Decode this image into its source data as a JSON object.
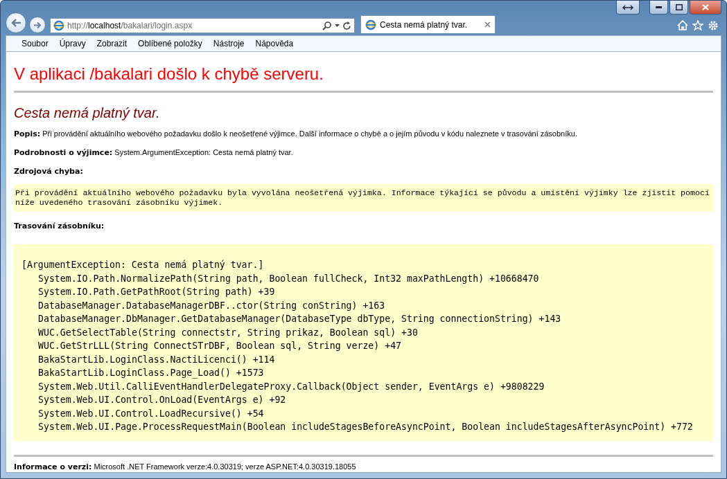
{
  "browser": {
    "address_scheme": "http://",
    "address_host": "localhost",
    "address_path": "/bakalari/login.aspx",
    "tab": {
      "title": "Cesta nemá platný tvar.",
      "selected": true
    }
  },
  "menu": [
    "Soubor",
    "Úpravy",
    "Zobrazit",
    "Oblíbené položky",
    "Nástroje",
    "Nápověda"
  ],
  "page": {
    "title": "V aplikaci /bakalari došlo k chybě serveru.",
    "subtitle": "Cesta nemá platný tvar.",
    "description": {
      "label": "Popis:",
      "text": "Při provádění aktuálního webového požadavku došlo k neošetřené výjimce. Další informace o chybě a o jejím původu v kódu naleznete v trasování zásobníku."
    },
    "exception": {
      "label": "Podrobnosti o výjimce:",
      "text": "System.ArgumentException: Cesta nemá platný tvar."
    },
    "source_error": {
      "label": "Zdrojová chyba:",
      "text": "Při provádění aktuálního webového požadavku byla vyvolána neošetřená výjimka. Informace týkající se původu a umístění výjimky lze zjistit pomocí níže uvedeného trasování zásobníku výjimek."
    },
    "stack_trace": {
      "label": "Trasování zásobníku:",
      "exception_line": "[ArgumentException: Cesta nemá platný tvar.]",
      "frames": [
        "System.IO.Path.NormalizePath(String path, Boolean fullCheck, Int32 maxPathLength) +10668470",
        "System.IO.Path.GetPathRoot(String path) +39",
        "DatabaseManager.DatabaseManagerDBF..ctor(String conString) +163",
        "DatabaseManager.DbManager.GetDatabaseManager(DatabaseType dbType, String connectionString) +143",
        "WUC.GetSelectTable(String connectstr, String prikaz, Boolean sql) +30",
        "WUC.GetStrLLL(String ConnectSTrDBF, Boolean sql, String verze) +47",
        "BakaStartLib.LoginClass.NactiLicenci() +114",
        "BakaStartLib.LoginClass.Page_Load() +1573",
        "System.Web.Util.CalliEventHandlerDelegateProxy.Callback(Object sender, EventArgs e) +9808229",
        "System.Web.UI.Control.OnLoad(EventArgs e) +92",
        "System.Web.UI.Control.LoadRecursive() +54",
        "System.Web.UI.Page.ProcessRequestMain(Boolean includeStagesBeforeAsyncPoint, Boolean includeStagesAfterAsyncPoint) +772"
      ]
    },
    "version": {
      "label": "Informace o verzi:",
      "text": "Microsoft .NET Framework verze:4.0.30319; verze ASP.NET:4.0.30319.18055"
    }
  }
}
